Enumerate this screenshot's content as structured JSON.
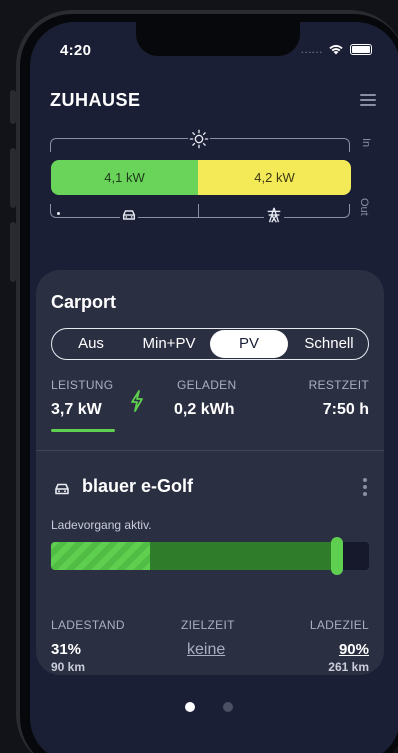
{
  "status_bar": {
    "time": "4:20",
    "signal": "……"
  },
  "header": {
    "title": "ZUHAUSE"
  },
  "energy_flow": {
    "grid_in_kw": "4,1 kW",
    "grid_out_kw": "4,2 kW",
    "in_label": "In",
    "out_label": "Out",
    "colors": {
      "green": "#6ad45a",
      "yellow": "#f4ea58"
    }
  },
  "card": {
    "title": "Carport",
    "modes": [
      "Aus",
      "Min+PV",
      "PV",
      "Schnell"
    ],
    "active_mode": "PV",
    "stats": {
      "leistung_label": "LEISTUNG",
      "leistung_value": "3,7 kW",
      "geladen_label": "GELADEN",
      "geladen_value": "0,2 kWh",
      "restzeit_label": "RESTZEIT",
      "restzeit_value": "7:50 h"
    },
    "vehicle": {
      "name": "blauer e-Golf",
      "status": "Ladevorgang aktiv.",
      "charge_fraction": 0.31,
      "target_fraction": 0.9,
      "ladestand_label": "LADESTAND",
      "ladestand_value": "31%",
      "ladestand_km": "90 km",
      "zielzeit_label": "ZIELZEIT",
      "zielzeit_value": "keine",
      "ladeziel_label": "LADEZIEL",
      "ladeziel_value": "90%",
      "ladeziel_km": "261 km"
    }
  },
  "pagination": {
    "pages": 2,
    "active": 0
  },
  "accent": "#5ecf4e",
  "background": "#1a1f36"
}
